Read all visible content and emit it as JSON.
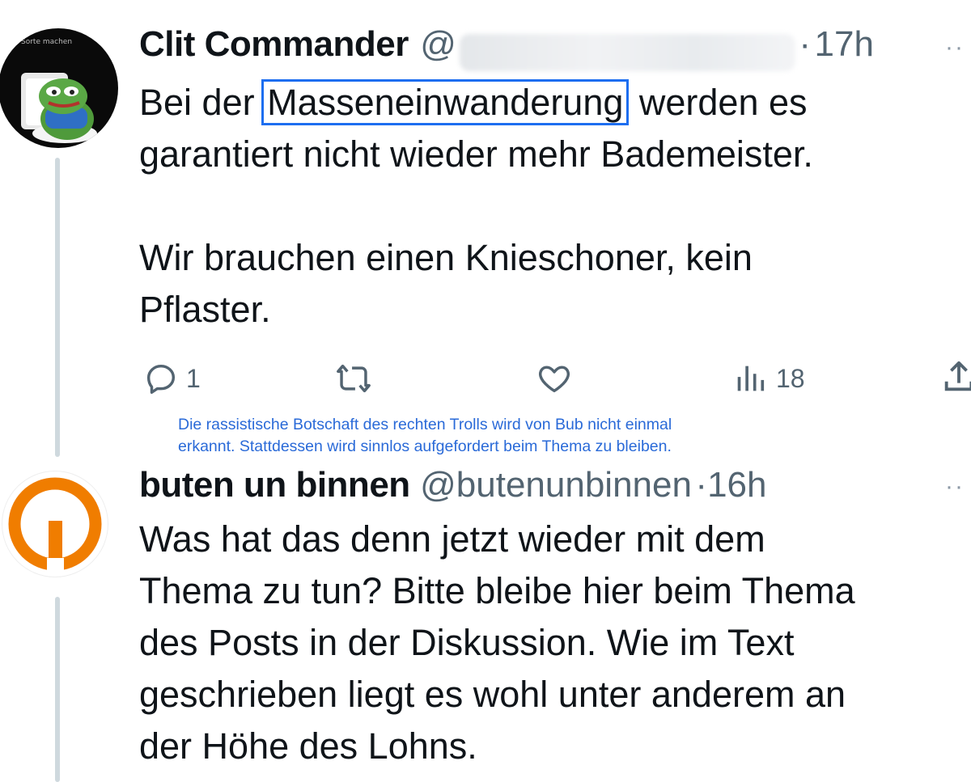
{
  "annotation": {
    "line1": "Die rassistische Botschaft des rechten Trolls wird von Bub nicht einmal",
    "line2": "erkannt. Stattdessen wird sinnlos aufgefordert beim Thema zu bleiben."
  },
  "tweets": [
    {
      "author": "Clit Commander",
      "handle_prefix": "@",
      "handle_redacted": true,
      "separator": "·",
      "time": "17h",
      "more": "··",
      "avatar_caption": "Sorte machen",
      "body": {
        "line1_before": "Bei der ",
        "highlight": "Masseneinwanderung",
        "line1_after": " werden es",
        "line2": "garantiert nicht wieder mehr Bademeister.",
        "line3": "Wir brauchen einen Knieschoner, kein",
        "line4": "Pflaster."
      },
      "actions": {
        "replies": "1",
        "retweets": "",
        "likes": "",
        "views": "18"
      }
    },
    {
      "author": "buten un binnen",
      "handle": "@butenunbinnen",
      "separator": "·",
      "time": "16h",
      "more": "··",
      "body": {
        "line1": "Was hat das denn jetzt wieder mit dem",
        "line2": "Thema zu tun? Bitte bleibe hier beim Thema",
        "line3": "des Posts in der Diskussion. Wie im Text",
        "line4": "geschrieben liegt es wohl unter anderem an",
        "line5": "der Höhe des Lohns."
      }
    }
  ],
  "colors": {
    "text": "#0f1419",
    "secondary": "#536471",
    "highlight_box": "#1d6ef0",
    "annotation": "#2a6ad8",
    "thread_line": "#cfd9de",
    "brand_orange": "#f07d00"
  },
  "icons": [
    "reply-icon",
    "retweet-icon",
    "like-icon",
    "views-icon",
    "share-icon"
  ]
}
